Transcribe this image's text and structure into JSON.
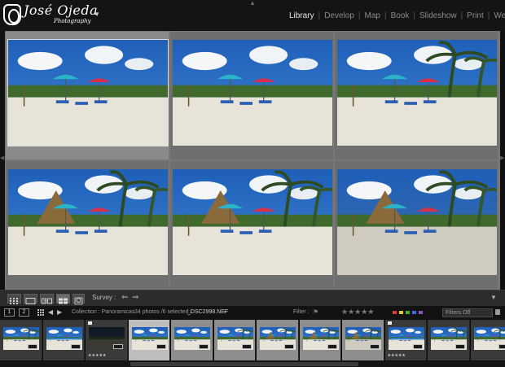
{
  "app": {
    "identity": {
      "name": "José Ojeda",
      "subtitle": "Photography"
    },
    "modules": [
      {
        "label": "Library",
        "active": true
      },
      {
        "label": "Develop",
        "active": false
      },
      {
        "label": "Map",
        "active": false
      },
      {
        "label": "Book",
        "active": false
      },
      {
        "label": "Slideshow",
        "active": false
      },
      {
        "label": "Print",
        "active": false
      },
      {
        "label": "Web",
        "active": false
      }
    ]
  },
  "toolbar": {
    "survey_label": "Survey :",
    "view_icons": [
      "grid-view-icon",
      "loupe-view-icon",
      "compare-view-icon",
      "survey-view-icon",
      "people-view-icon"
    ]
  },
  "filmstrip_bar": {
    "page_buttons": [
      "1",
      "2"
    ],
    "collection_text": "Collection : Panoramicas",
    "count_text": "34 photos /6 selected /",
    "file_text": "_DSC2998.NEF",
    "filter_label": "Filter :",
    "filter_stars": "★★★★★",
    "filters_off": "Filters Off",
    "label_colors": [
      "#e23b3b",
      "#e0c52f",
      "#3fae3f",
      "#3a6fd8",
      "#8b4fc9"
    ]
  },
  "grid": {
    "photos": [
      {
        "scene": "beach-umbrellas",
        "selected": true,
        "primary": true
      },
      {
        "scene": "beach-umbrellas",
        "selected": false,
        "primary": false
      },
      {
        "scene": "beach-palms",
        "selected": false,
        "primary": false
      },
      {
        "scene": "beach-hut",
        "selected": false,
        "primary": false
      },
      {
        "scene": "beach-hut",
        "selected": false,
        "primary": false
      },
      {
        "scene": "beach-hut-dark",
        "selected": false,
        "primary": false
      }
    ]
  },
  "filmstrip": {
    "frames": [
      {
        "scene": "beach-palms",
        "selected": false,
        "primary": false,
        "flag": false,
        "stars": ""
      },
      {
        "scene": "beach-blue",
        "selected": false,
        "primary": false,
        "flag": false,
        "stars": ""
      },
      {
        "scene": "dark",
        "selected": false,
        "primary": false,
        "flag": true,
        "stars": "★★★★★"
      },
      {
        "scene": "beach-umbrellas",
        "selected": true,
        "primary": true,
        "flag": false,
        "stars": ""
      },
      {
        "scene": "beach-umbrellas",
        "selected": true,
        "primary": false,
        "flag": false,
        "stars": ""
      },
      {
        "scene": "beach-palms",
        "selected": true,
        "primary": false,
        "flag": false,
        "stars": ""
      },
      {
        "scene": "beach-hut",
        "selected": true,
        "primary": false,
        "flag": false,
        "stars": ""
      },
      {
        "scene": "beach-hut",
        "selected": true,
        "primary": false,
        "flag": false,
        "stars": ""
      },
      {
        "scene": "beach-hut-dark",
        "selected": true,
        "primary": false,
        "flag": false,
        "stars": ""
      },
      {
        "scene": "beach-blue",
        "selected": false,
        "primary": false,
        "flag": true,
        "stars": "★★★★★"
      },
      {
        "scene": "beach-palms",
        "selected": false,
        "primary": false,
        "flag": false,
        "stars": ""
      },
      {
        "scene": "beach-palms",
        "selected": false,
        "primary": false,
        "flag": false,
        "stars": ""
      }
    ]
  }
}
